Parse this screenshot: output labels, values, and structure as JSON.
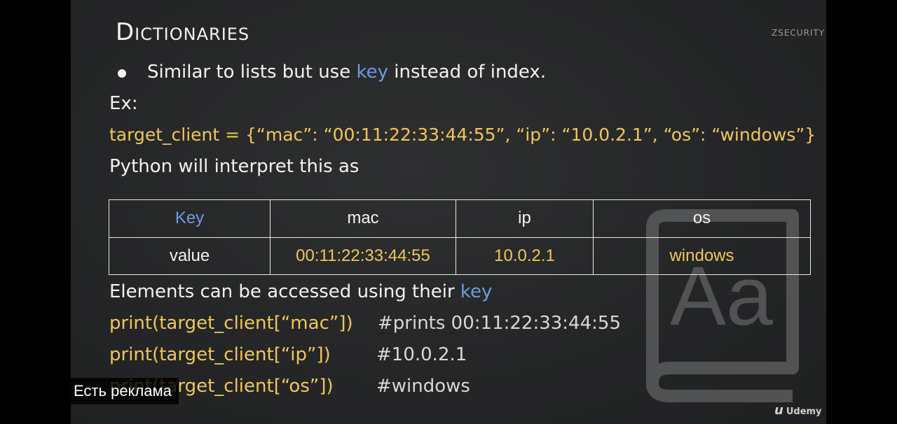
{
  "slide": {
    "title": "Dictionaries",
    "brand": "ZSECURITY",
    "bullet": {
      "text_before": "Similar to lists but use ",
      "keyword": "key",
      "text_after": " instead of index."
    },
    "example_label": "Ex:",
    "code_line": "target_client = {“mac”: “00:11:22:33:44:55”, “ip”: “10.0.2.1”, “os”: “windows”}",
    "interpret_text": "Python will interpret this as",
    "table": {
      "header": [
        "Key",
        "mac",
        "ip",
        "os"
      ],
      "values": [
        "value",
        "00:11:22:33:44:55",
        "10.0.2.1",
        "windows"
      ]
    },
    "access": {
      "text_before": "Elements can be accessed using their ",
      "keyword": "key"
    },
    "examples": [
      {
        "code": "print(target_client[“mac”])",
        "comment": "#prints 00:11:22:33:44:55"
      },
      {
        "code": "print(target_client[“ip”])",
        "comment": "#10.0.2.1"
      },
      {
        "code": "print(target_client[“os”])",
        "comment": "#windows"
      }
    ],
    "watermark_icon": "dictionary-book-icon",
    "watermark_text": "Aa"
  },
  "overlay": {
    "ad_label": "Есть реклама",
    "udemy_logo": "Udemy"
  },
  "colors": {
    "highlight_blue": "#6f9be0",
    "code_yellow": "#f0c659",
    "slide_background": "#2a2b2c"
  }
}
